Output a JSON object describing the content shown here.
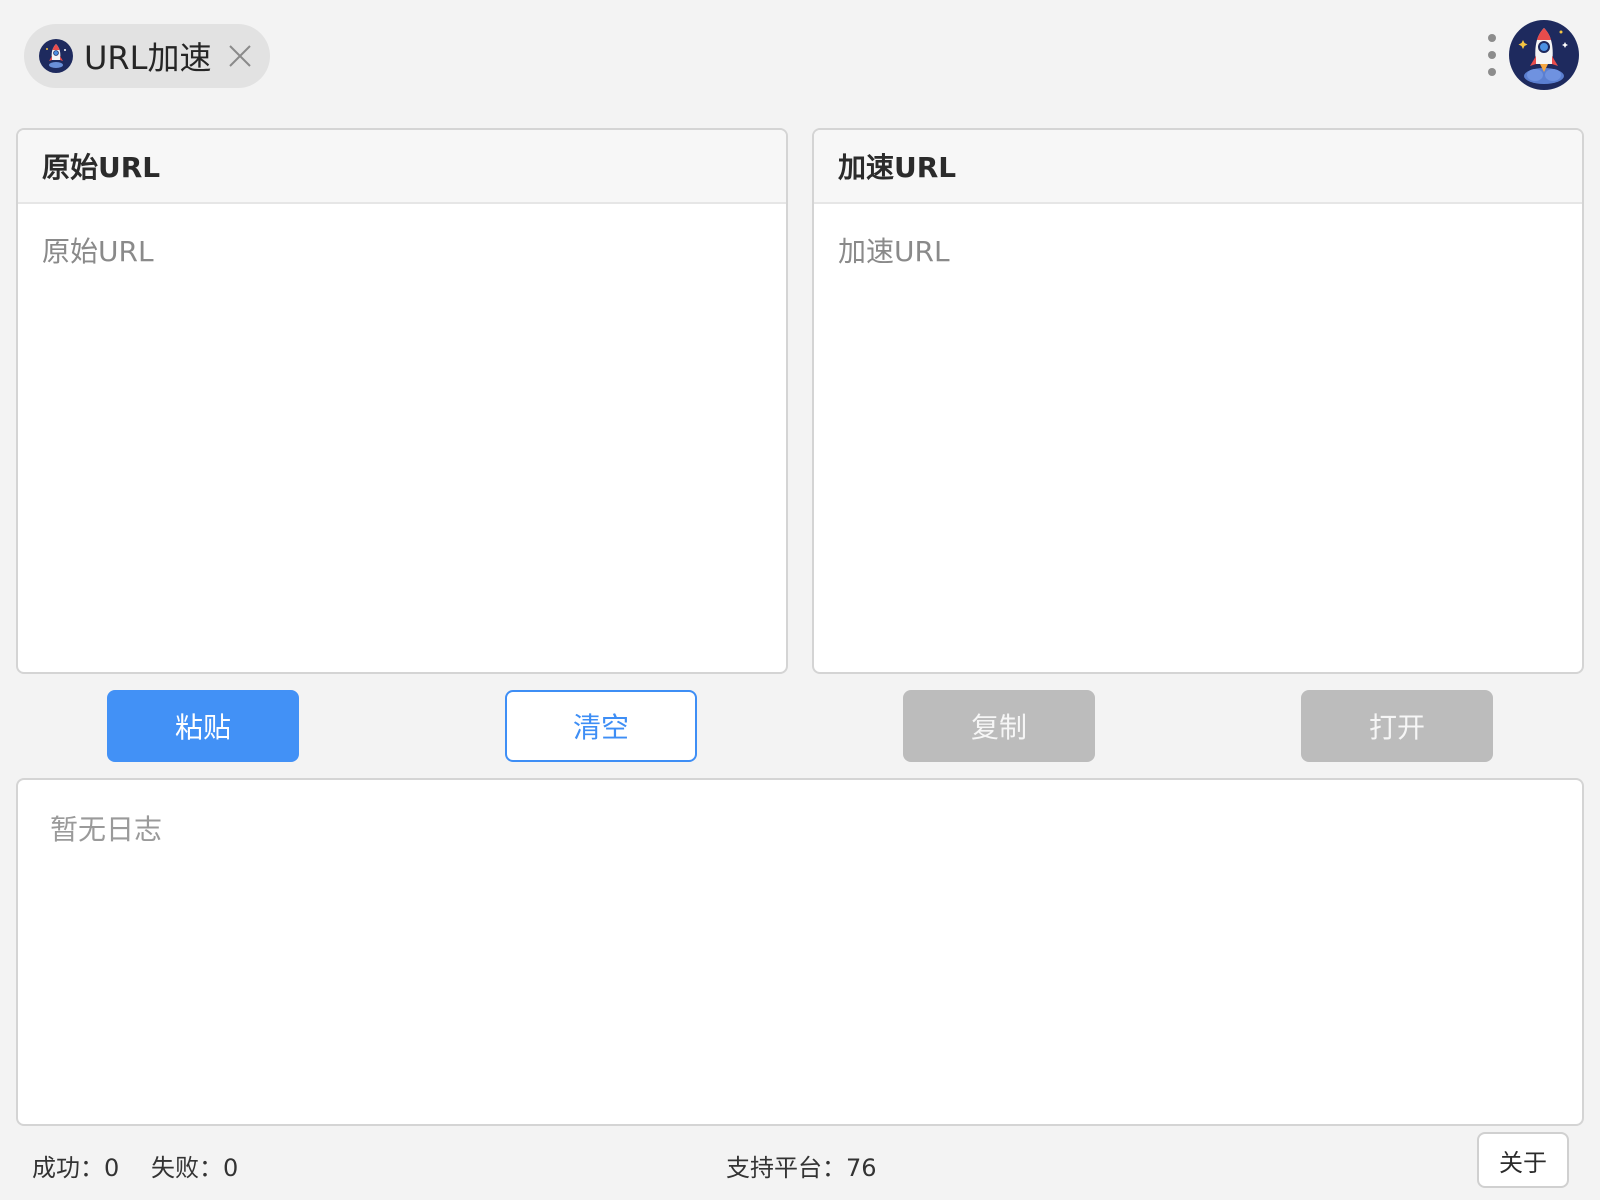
{
  "header": {
    "tab_title": "URL加速",
    "tab_icon": "rocket-icon",
    "close_icon": "close-icon",
    "menu_icon": "more-vertical-icon",
    "avatar_icon": "rocket-avatar-icon"
  },
  "source_panel": {
    "title": "原始URL",
    "placeholder": "原始URL",
    "value": ""
  },
  "accelerated_panel": {
    "title": "加速URL",
    "placeholder": "加速URL",
    "value": ""
  },
  "actions": {
    "paste_label": "粘贴",
    "clear_label": "清空",
    "copy_label": "复制",
    "open_label": "打开"
  },
  "log": {
    "empty_text": "暂无日志"
  },
  "status": {
    "success_text": "成功：0",
    "fail_text": "失败：0",
    "platforms_text": "支持平台：76",
    "about_label": "关于"
  },
  "colors": {
    "accent": "#4291f6",
    "disabled": "#bcbcbc",
    "background": "#f3f3f3",
    "rocket_badge": "#1e2a5e"
  }
}
